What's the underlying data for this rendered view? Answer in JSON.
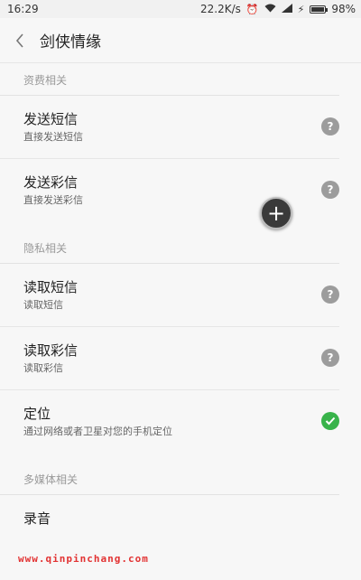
{
  "status_bar": {
    "time": "16:29",
    "network_speed": "22.2K/s",
    "battery": "98%",
    "battery_level": 0.98,
    "icons": [
      "alarm-icon",
      "wifi-icon",
      "signal-icon",
      "charging-icon"
    ]
  },
  "header": {
    "title": "剑侠情缘",
    "back_icon": "chevron-left-icon"
  },
  "sections": [
    {
      "header": "资费相关",
      "items": [
        {
          "title": "发送短信",
          "subtitle": "直接发送短信",
          "status": "ask"
        },
        {
          "title": "发送彩信",
          "subtitle": "直接发送彩信",
          "status": "ask"
        }
      ]
    },
    {
      "header": "隐私相关",
      "items": [
        {
          "title": "读取短信",
          "subtitle": "读取短信",
          "status": "ask"
        },
        {
          "title": "读取彩信",
          "subtitle": "读取彩信",
          "status": "ask"
        },
        {
          "title": "定位",
          "subtitle": "通过网络或者卫星对您的手机定位",
          "status": "allowed"
        }
      ]
    },
    {
      "header": "多媒体相关",
      "items": [
        {
          "title": "录音",
          "subtitle": "",
          "status": "ask"
        }
      ]
    }
  ],
  "fab": {
    "symbol": "+"
  },
  "watermark": "www.qinpinchang.com",
  "colors": {
    "allowed": "#38b34a",
    "ask": "#9c9c9c",
    "watermark": "#e23232"
  }
}
